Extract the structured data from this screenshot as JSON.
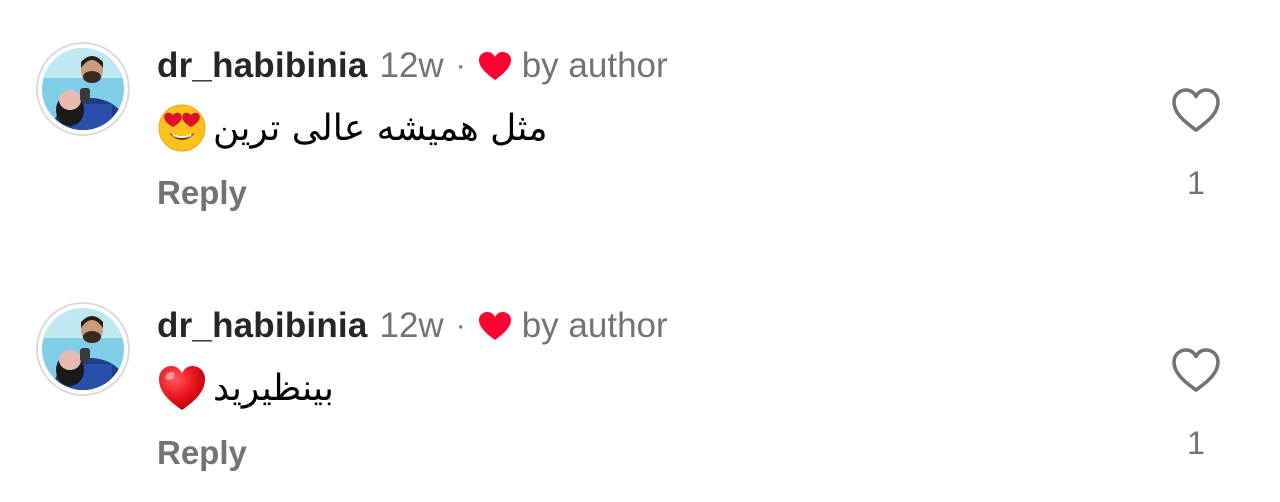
{
  "comments": [
    {
      "username": "dr_habibinia",
      "time": "12w",
      "separator": "·",
      "author_badge": "by author",
      "emoji_icon": "heart-eyes-emoji",
      "text": "مثل همیشه عالی ترین",
      "reply_label": "Reply",
      "like_count": "1"
    },
    {
      "username": "dr_habibinia",
      "time": "12w",
      "separator": "·",
      "author_badge": "by author",
      "emoji_icon": "red-heart-emoji",
      "text": "بینظیرید",
      "reply_label": "Reply",
      "like_count": "1"
    }
  ],
  "colors": {
    "liked_heart": "#ff0033",
    "secondary_text": "#737373",
    "primary_text": "#262626"
  }
}
